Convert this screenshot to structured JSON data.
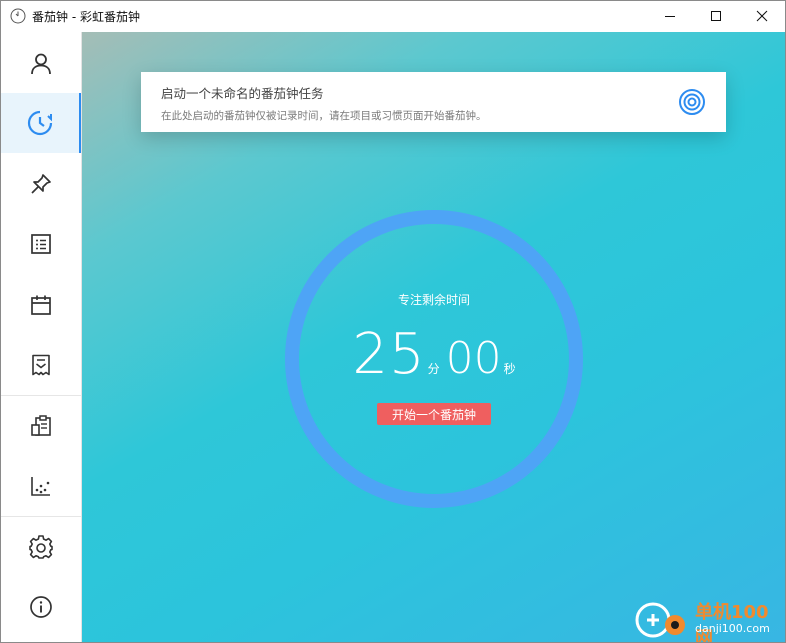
{
  "window": {
    "title": "番茄钟 - 彩虹番茄钟",
    "controls": [
      "minimize",
      "maximize",
      "close"
    ]
  },
  "sidebar": {
    "items": [
      {
        "icon": "user-icon",
        "active": false
      },
      {
        "icon": "clock-icon",
        "active": true
      },
      {
        "icon": "pin-icon",
        "active": false
      },
      {
        "icon": "list-icon",
        "active": false
      },
      {
        "icon": "calendar-icon",
        "active": false
      },
      {
        "icon": "document-icon",
        "active": false
      },
      {
        "icon": "clipboard-icon",
        "active": false
      },
      {
        "icon": "scatter-chart-icon",
        "active": false
      },
      {
        "icon": "gear-icon",
        "active": false
      },
      {
        "icon": "info-icon",
        "active": false
      }
    ],
    "active_color": "#2d8cf0"
  },
  "task_card": {
    "title": "启动一个未命名的番茄钟任务",
    "subtitle": "在此处启动的番茄钟仅被记录时间，请在项目或习惯页面开始番茄钟。",
    "icon": "target-icon"
  },
  "timer": {
    "label": "专注剩余时间",
    "minutes": "25",
    "minutes_unit": "分",
    "seconds": "00",
    "seconds_unit": "秒",
    "ring_color": "#4ea4f6"
  },
  "start_button": {
    "label": "开始一个番茄钟",
    "color": "#ef5f5f"
  },
  "watermark": {
    "line1": "单机100网",
    "line2": "danji100.com"
  }
}
